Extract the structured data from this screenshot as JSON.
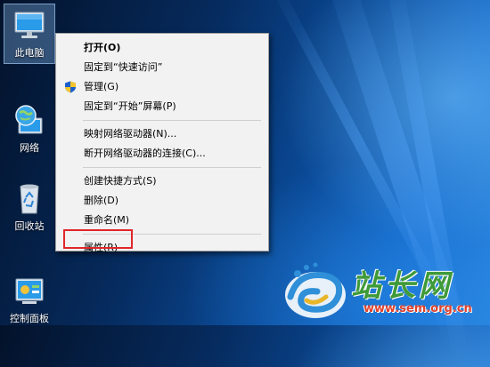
{
  "desktop": {
    "icons": [
      {
        "label": "此电脑",
        "icon": "computer-icon",
        "selected": true
      },
      {
        "label": "网络",
        "icon": "network-globe-icon"
      },
      {
        "label": "回收站",
        "icon": "recycle-bin-icon"
      },
      {
        "label": "控制面板",
        "icon": "control-panel-icon"
      }
    ]
  },
  "context_menu": {
    "items": [
      {
        "label": "打开(O)",
        "bold": true
      },
      {
        "label": "固定到“快速访问”"
      },
      {
        "label": "管理(G)",
        "icon": "uac-shield-icon"
      },
      {
        "label": "固定到“开始”屏幕(P)"
      },
      {
        "label": "映射网络驱动器(N)..."
      },
      {
        "label": "断开网络驱动器的连接(C)..."
      },
      {
        "label": "创建快捷方式(S)"
      },
      {
        "label": "删除(D)"
      },
      {
        "label": "重命名(M)"
      },
      {
        "label": "属性(R)",
        "highlighted": true
      }
    ]
  },
  "watermark": {
    "brand": "站长网",
    "url": "www.sem.org.cn"
  },
  "colors": {
    "highlight_box": "#e1262b",
    "menu_bg": "#f2f2f2",
    "watermark_green": "#3f9a3a",
    "watermark_red": "#e0412b"
  }
}
